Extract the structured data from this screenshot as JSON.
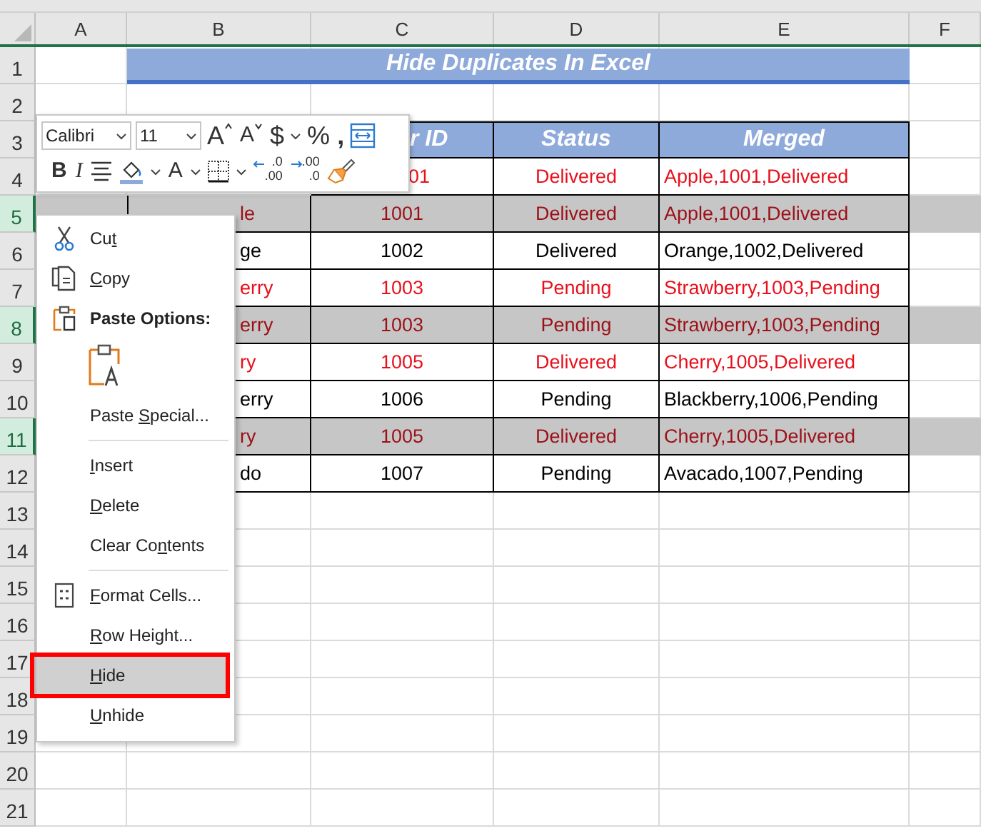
{
  "sheet": {
    "column_headers": [
      "A",
      "B",
      "C",
      "D",
      "E",
      "F"
    ],
    "rows": [
      {
        "number": "1",
        "selected": false,
        "kind": "title",
        "text": "Hide Duplicates In Excel"
      },
      {
        "number": "2",
        "selected": false,
        "kind": "empty"
      },
      {
        "number": "3",
        "selected": false,
        "kind": "header",
        "col_c": {
          "text": "r ID",
          "partial": true
        },
        "col_d": {
          "text": "Status"
        },
        "col_e": {
          "text": "Merged"
        }
      },
      {
        "number": "4",
        "selected": false,
        "kind": "data",
        "color": "#e8101c",
        "col_c": {
          "text": "01",
          "partial": true
        },
        "col_d": {
          "text": "Delivered"
        },
        "col_e": {
          "text": "Apple,1001,Delivered"
        }
      },
      {
        "number": "5",
        "selected": true,
        "kind": "data",
        "color": "#9c1018",
        "col_b": {
          "text": "le",
          "partial": true
        },
        "col_c": {
          "text": "1001"
        },
        "col_d": {
          "text": "Delivered"
        },
        "col_e": {
          "text": "Apple,1001,Delivered"
        }
      },
      {
        "number": "6",
        "selected": false,
        "kind": "data",
        "color": "#000000",
        "col_b": {
          "text": "ge",
          "partial": true
        },
        "col_c": {
          "text": "1002"
        },
        "col_d": {
          "text": "Delivered"
        },
        "col_e": {
          "text": "Orange,1002,Delivered"
        }
      },
      {
        "number": "7",
        "selected": false,
        "kind": "data",
        "color": "#e8101c",
        "col_b": {
          "text": "erry",
          "partial": true
        },
        "col_c": {
          "text": "1003"
        },
        "col_d": {
          "text": "Pending"
        },
        "col_e": {
          "text": "Strawberry,1003,Pending"
        }
      },
      {
        "number": "8",
        "selected": true,
        "kind": "data",
        "color": "#9c1018",
        "col_b": {
          "text": "erry",
          "partial": true
        },
        "col_c": {
          "text": "1003"
        },
        "col_d": {
          "text": "Pending"
        },
        "col_e": {
          "text": "Strawberry,1003,Pending"
        }
      },
      {
        "number": "9",
        "selected": false,
        "kind": "data",
        "color": "#e8101c",
        "col_b": {
          "text": "ry",
          "partial": true
        },
        "col_c": {
          "text": "1005"
        },
        "col_d": {
          "text": "Delivered"
        },
        "col_e": {
          "text": "Cherry,1005,Delivered"
        }
      },
      {
        "number": "10",
        "selected": false,
        "kind": "data",
        "color": "#000000",
        "col_b": {
          "text": "erry",
          "partial": true
        },
        "col_c": {
          "text": "1006"
        },
        "col_d": {
          "text": "Pending"
        },
        "col_e": {
          "text": "Blackberry,1006,Pending"
        }
      },
      {
        "number": "11",
        "selected": true,
        "kind": "data",
        "color": "#9c1018",
        "col_b": {
          "text": "ry",
          "partial": true
        },
        "col_c": {
          "text": "1005"
        },
        "col_d": {
          "text": "Delivered"
        },
        "col_e": {
          "text": "Cherry,1005,Delivered"
        }
      },
      {
        "number": "12",
        "selected": false,
        "kind": "data",
        "color": "#000000",
        "col_b": {
          "text": "do",
          "partial": true
        },
        "col_c": {
          "text": "1007"
        },
        "col_d": {
          "text": "Pending"
        },
        "col_e": {
          "text": "Avacado,1007,Pending"
        }
      },
      {
        "number": "13",
        "selected": false,
        "kind": "empty"
      },
      {
        "number": "14",
        "selected": false,
        "kind": "empty"
      },
      {
        "number": "15",
        "selected": false,
        "kind": "empty"
      },
      {
        "number": "16",
        "selected": false,
        "kind": "empty"
      },
      {
        "number": "17",
        "selected": false,
        "kind": "empty"
      },
      {
        "number": "18",
        "selected": false,
        "kind": "empty"
      },
      {
        "number": "19",
        "selected": false,
        "kind": "empty"
      },
      {
        "number": "20",
        "selected": false,
        "kind": "empty"
      },
      {
        "number": "21",
        "selected": false,
        "kind": "empty"
      }
    ]
  },
  "mini_toolbar": {
    "font_field": "Calibri",
    "size_field": "11",
    "row_1": [
      {
        "kind": "grow-font",
        "text": "A"
      },
      {
        "kind": "shrink-font",
        "text": "A"
      },
      {
        "kind": "currency",
        "text": "$",
        "dropdown": true
      },
      {
        "kind": "percent",
        "text": "%"
      },
      {
        "kind": "comma",
        "text": ","
      },
      {
        "kind": "merge"
      }
    ],
    "row_2": [
      {
        "kind": "bold",
        "text": "B"
      },
      {
        "kind": "italic",
        "text": "I"
      },
      {
        "kind": "align"
      },
      {
        "kind": "fill-color",
        "dropdown": true
      },
      {
        "kind": "font-color",
        "text": "A",
        "dropdown": true
      },
      {
        "kind": "borders",
        "dropdown": true
      },
      {
        "kind": "decrease-decimal",
        "top": ".0",
        "bottom": ".00"
      },
      {
        "kind": "increase-decimal",
        "top": ".00",
        "bottom": ".0"
      },
      {
        "kind": "format-painter"
      }
    ]
  },
  "context_menu": [
    {
      "kind": "cut",
      "pre": "Cu",
      "key": "t",
      "selected": false
    },
    {
      "kind": "copy",
      "key": "C",
      "post": "opy",
      "selected": false
    },
    {
      "kind": "paste-heading",
      "text": "Paste Options:"
    },
    {
      "kind": "paste-option",
      "selected": false
    },
    {
      "kind": "command",
      "pre": "Paste ",
      "key": "S",
      "post": "pecial...",
      "selected": false
    },
    {
      "kind": "separator"
    },
    {
      "kind": "command",
      "key": "I",
      "post": "nsert",
      "selected": false
    },
    {
      "kind": "command",
      "key": "D",
      "post": "elete",
      "selected": false
    },
    {
      "kind": "command",
      "pre": "Clear Co",
      "key": "n",
      "post": "tents",
      "selected": false
    },
    {
      "kind": "separator"
    },
    {
      "kind": "format-cells",
      "key": "F",
      "post": "ormat Cells...",
      "selected": false
    },
    {
      "kind": "command",
      "key": "R",
      "post": "ow Height...",
      "selected": false
    },
    {
      "kind": "command",
      "key": "H",
      "post": "ide",
      "selected": true
    },
    {
      "kind": "command",
      "key": "U",
      "post": "nhide",
      "selected": false
    }
  ]
}
